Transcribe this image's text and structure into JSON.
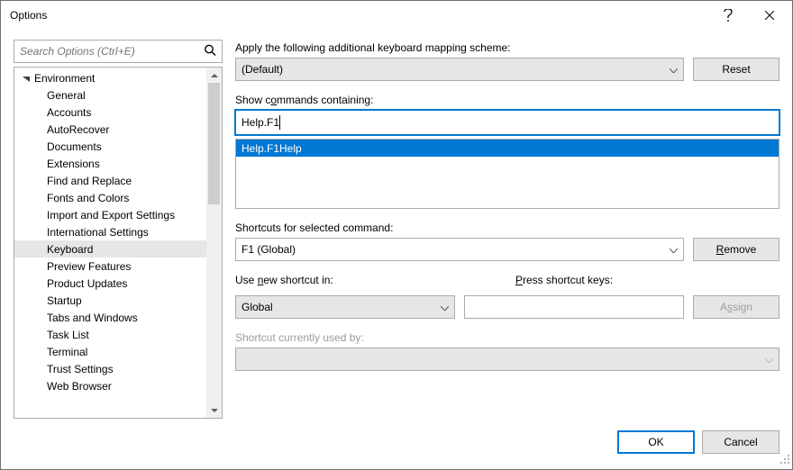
{
  "window": {
    "title": "Options"
  },
  "search": {
    "placeholder": "Search Options (Ctrl+E)"
  },
  "tree": {
    "root": "Environment",
    "items": [
      "General",
      "Accounts",
      "AutoRecover",
      "Documents",
      "Extensions",
      "Find and Replace",
      "Fonts and Colors",
      "Import and Export Settings",
      "International Settings",
      "Keyboard",
      "Preview Features",
      "Product Updates",
      "Startup",
      "Tabs and Windows",
      "Task List",
      "Terminal",
      "Trust Settings",
      "Web Browser"
    ],
    "selected_index": 9
  },
  "scheme": {
    "label": "Apply the following additional keyboard mapping scheme:",
    "value": "(Default)",
    "reset": "Reset"
  },
  "filter": {
    "label_pre": "Show c",
    "label_u": "o",
    "label_post": "mmands containing:",
    "value": "Help.F1"
  },
  "commands": {
    "selected": "Help.F1Help"
  },
  "shortcuts": {
    "label": "Shortcuts for selected command:",
    "value": "F1 (Global)",
    "remove_pre": "",
    "remove_u": "R",
    "remove_post": "emove"
  },
  "new_shortcut": {
    "use_pre": "Use ",
    "use_u": "n",
    "use_post": "ew shortcut in:",
    "scope": "Global",
    "press_u": "P",
    "press_post": "ress shortcut keys:",
    "value": "",
    "assign_pre": "A",
    "assign_u": "s",
    "assign_post": "sign"
  },
  "used": {
    "label": "Shortcut currently used by:"
  },
  "footer": {
    "ok": "OK",
    "cancel": "Cancel"
  }
}
